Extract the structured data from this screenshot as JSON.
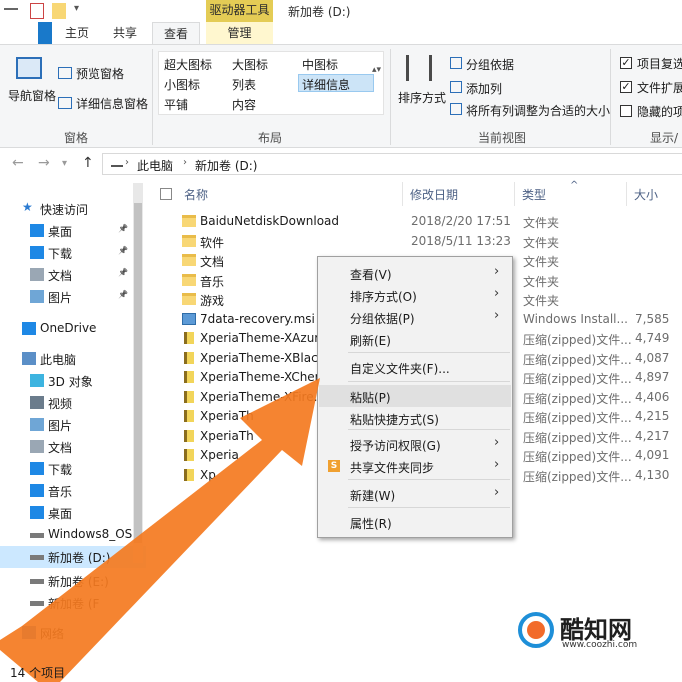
{
  "window": {
    "title": "新加卷 (D:)",
    "context_tab": "驱动器工具"
  },
  "tabs": [
    "主页",
    "共享",
    "查看",
    "管理"
  ],
  "ribbon": {
    "pane": {
      "nav_pane": "导航窗格",
      "preview_pane": "预览窗格",
      "details_pane": "详细信息窗格",
      "label": "窗格"
    },
    "layout": {
      "items": [
        "超大图标",
        "大图标",
        "中图标",
        "小图标",
        "列表",
        "详细信息",
        "平铺",
        "内容"
      ],
      "label": "布局"
    },
    "current_view": {
      "sort": "排序方式",
      "group_by": "分组依据",
      "add_col": "添加列",
      "fit_cols": "将所有列调整为合适的大小",
      "label": "当前视图"
    },
    "show_hide": {
      "item_check": "项目复选",
      "file_ext": "文件扩展",
      "hidden": "隐藏的项",
      "label": "显示/"
    }
  },
  "address": {
    "this_pc": "此电脑",
    "drive": "新加卷 (D:)"
  },
  "nav": {
    "items": [
      {
        "label": "快速访问",
        "icon": "star-icon"
      },
      {
        "label": "桌面",
        "icon": "desktop-icon",
        "pinned": true
      },
      {
        "label": "下载",
        "icon": "download-icon",
        "pinned": true
      },
      {
        "label": "文档",
        "icon": "document-icon",
        "pinned": true
      },
      {
        "label": "图片",
        "icon": "picture-icon",
        "pinned": true
      },
      {
        "label": "OneDrive",
        "icon": "cloud-icon"
      },
      {
        "label": "此电脑",
        "icon": "pc-icon"
      },
      {
        "label": "3D 对象",
        "icon": "cube-icon"
      },
      {
        "label": "视频",
        "icon": "video-icon"
      },
      {
        "label": "图片",
        "icon": "picture-icon"
      },
      {
        "label": "文档",
        "icon": "document-icon"
      },
      {
        "label": "下载",
        "icon": "download-icon"
      },
      {
        "label": "音乐",
        "icon": "music-icon"
      },
      {
        "label": "桌面",
        "icon": "desktop-icon"
      },
      {
        "label": "Windows8_OS",
        "icon": "drive-icon"
      },
      {
        "label": "新加卷 (D:)",
        "icon": "drive-icon",
        "selected": true
      },
      {
        "label": "新加卷 (E:)",
        "icon": "drive-icon"
      },
      {
        "label": "新加卷 (F",
        "icon": "drive-icon"
      },
      {
        "label": "网络",
        "icon": "network-icon"
      }
    ]
  },
  "list": {
    "headers": {
      "name": "名称",
      "date": "修改日期",
      "type": "类型",
      "size": "大小"
    },
    "rows": [
      {
        "name": "BaiduNetdiskDownload",
        "date": "2018/2/20 17:51",
        "type": "文件夹",
        "size": "",
        "kind": "folder"
      },
      {
        "name": "软件",
        "date": "2018/5/11 13:23",
        "type": "文件夹",
        "size": "",
        "kind": "folder"
      },
      {
        "name": "文档",
        "date": "",
        "type": "文件夹",
        "size": "",
        "kind": "folder"
      },
      {
        "name": "音乐",
        "date": "",
        "type": "文件夹",
        "size": "",
        "kind": "folder"
      },
      {
        "name": "游戏",
        "date": "",
        "type": "文件夹",
        "size": "",
        "kind": "folder"
      },
      {
        "name": "7data-recovery.msi",
        "date": "",
        "type": "Windows Install...",
        "size": "7,585",
        "kind": "msi"
      },
      {
        "name": "XperiaTheme-XAzure",
        "date": "",
        "type": "压缩(zipped)文件...",
        "size": "4,749",
        "kind": "zip"
      },
      {
        "name": "XperiaTheme-XBlack.",
        "date": "",
        "type": "压缩(zipped)文件...",
        "size": "4,087",
        "kind": "zip"
      },
      {
        "name": "XperiaTheme-XCherry",
        "date": "",
        "type": "压缩(zipped)文件...",
        "size": "4,897",
        "kind": "zip"
      },
      {
        "name": "XperiaTheme-XFire.ap",
        "date": "",
        "type": "压缩(zipped)文件...",
        "size": "4,406",
        "kind": "zip"
      },
      {
        "name": "XperiaTh",
        "date": "",
        "type": "压缩(zipped)文件...",
        "size": "4,215",
        "kind": "zip"
      },
      {
        "name": "XperiaTh",
        "date": "",
        "type": "压缩(zipped)文件...",
        "size": "4,217",
        "kind": "zip"
      },
      {
        "name": "Xperia",
        "date": "",
        "type": "压缩(zipped)文件...",
        "size": "4,091",
        "kind": "zip"
      },
      {
        "name": "Xp",
        "date": "",
        "type": "压缩(zipped)文件...",
        "size": "4,130",
        "kind": "zip"
      }
    ]
  },
  "context_menu": {
    "items": [
      {
        "label": "查看(V)",
        "arrow": "›"
      },
      {
        "label": "排序方式(O)",
        "arrow": "›"
      },
      {
        "label": "分组依据(P)",
        "arrow": "›"
      },
      {
        "label": "刷新(E)",
        "arrow": ""
      },
      {
        "label": "自定义文件夹(F)...",
        "arrow": ""
      },
      {
        "label": "粘贴(P)",
        "arrow": "",
        "hover": true
      },
      {
        "label": "粘贴快捷方式(S)",
        "arrow": ""
      },
      {
        "label": "授予访问权限(G)",
        "arrow": "›"
      },
      {
        "label": "共享文件夹同步",
        "arrow": "›",
        "icon": "S"
      },
      {
        "label": "新建(W)",
        "arrow": "›"
      },
      {
        "label": "属性(R)",
        "arrow": ""
      }
    ]
  },
  "status": {
    "text": "14 个项目"
  },
  "watermark": {
    "title": "酷知网",
    "url": "www.coozhi.com"
  },
  "colors": {
    "arrow": "#f47a20",
    "selection": "#cce8ff",
    "accent": "#1979ca"
  }
}
